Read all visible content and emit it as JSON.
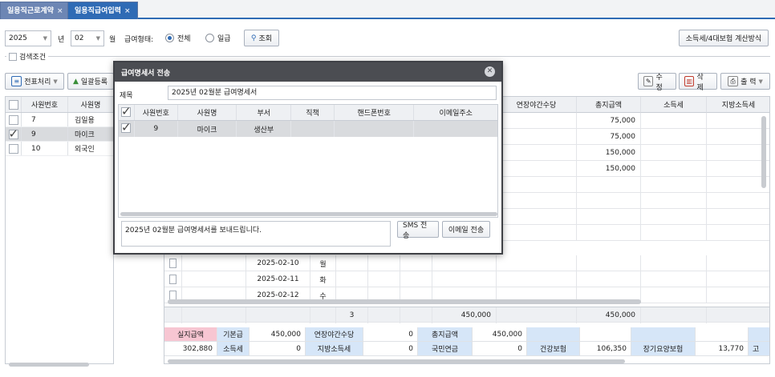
{
  "tabs": [
    {
      "label": "일용직근로계약",
      "close": "×"
    },
    {
      "label": "일용직급여입력",
      "close": "×"
    }
  ],
  "filters": {
    "year": "2025",
    "year_unit": "년",
    "month": "02",
    "month_unit": "월",
    "pay_type_label": "급여형태:",
    "radio_all": "전체",
    "radio_daily": "일급",
    "search_btn": "조회",
    "calc_btn": "소득세/4대보험 계산방식",
    "search_cond": "검색조건"
  },
  "toolbar": {
    "voucher": "전표처리",
    "bulk": "일괄등록",
    "edit": "수 정",
    "delete": "삭 제",
    "print": "출 력"
  },
  "left_grid": {
    "headers": [
      "사원번호",
      "사원명"
    ],
    "rows": [
      {
        "id": "7",
        "name": "김일용",
        "checked": false
      },
      {
        "id": "9",
        "name": "마이크",
        "checked": true
      },
      {
        "id": "10",
        "name": "외국인",
        "checked": false
      }
    ]
  },
  "right_grid": {
    "headers": [
      "연장야간수당",
      "총지급액",
      "소득세",
      "지방소득세"
    ],
    "totals_rows": [
      "75,000",
      "75,000",
      "150,000",
      "150,000"
    ],
    "date_rows": [
      {
        "date": "2025-02-10",
        "day": "월"
      },
      {
        "date": "2025-02-11",
        "day": "화"
      },
      {
        "date": "2025-02-12",
        "day": "수"
      }
    ],
    "footer": {
      "count": "3",
      "sum1": "450,000",
      "sum2": "450,000"
    }
  },
  "summary": {
    "row1": {
      "net_label": "실지급액",
      "base_label": "기본급",
      "base_val": "450,000",
      "ot_label": "연장야간수당",
      "ot_val": "0",
      "total_label": "총지급액",
      "total_val": "450,000"
    },
    "row2": {
      "net_val": "302,880",
      "tax_label": "소득세",
      "tax_val": "0",
      "local_label": "지방소득세",
      "local_val": "0",
      "pension_label": "국민연금",
      "pension_val": "0",
      "health_label": "건강보험",
      "health_val": "106,350",
      "ltc_label": "장기요양보험",
      "ltc_val": "13,770",
      "more": "고"
    }
  },
  "dialog": {
    "title": "급여명세서 전송",
    "subject_label": "제목",
    "subject": "2025년 02월분 급여명세서",
    "headers": [
      "사원번호",
      "사원명",
      "부서",
      "직책",
      "핸드폰번호",
      "이메일주소"
    ],
    "row": {
      "id": "9",
      "name": "마이크",
      "dept": "생산부",
      "title": "",
      "phone": "",
      "email": ""
    },
    "message": "2025년 02월분 급여명세서를 보내드립니다.",
    "sms_btn": "SMS 전송",
    "email_btn": "이메일 전송"
  },
  "colors": {
    "accent": "#2f6bb5",
    "net_pay": "#f7c6d2",
    "label_blue": "#d6e6f8",
    "dialog_header": "#4b4d52"
  }
}
